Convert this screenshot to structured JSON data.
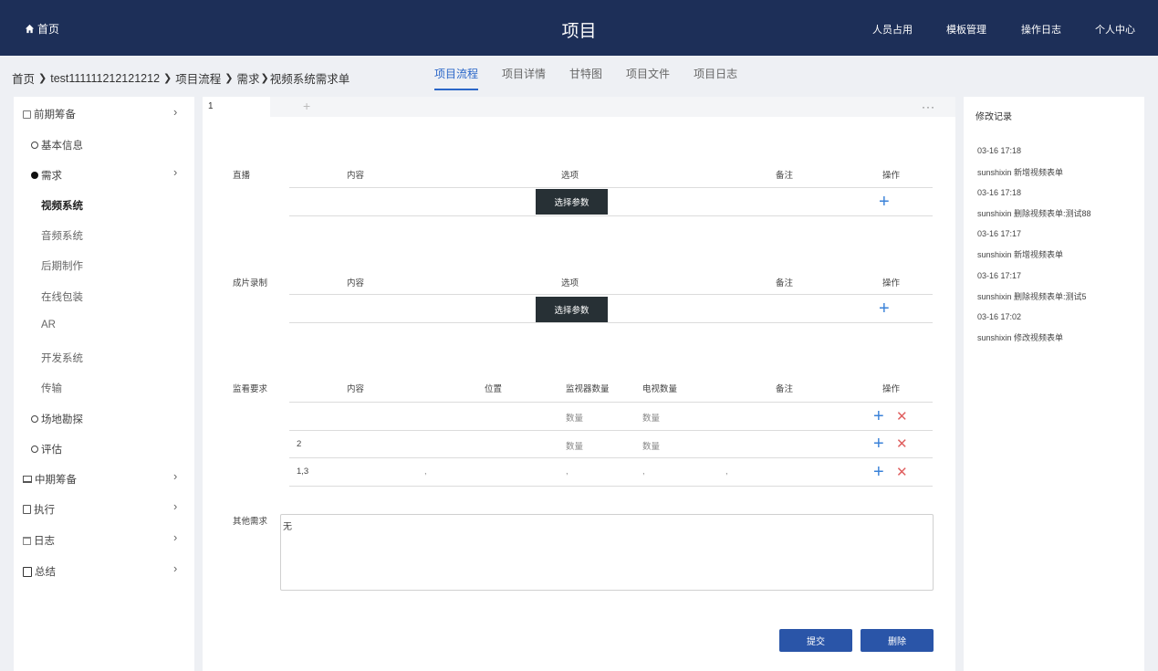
{
  "topbar": {
    "home_label": "首页",
    "title": "项目",
    "nav": [
      "人员占用",
      "模板管理",
      "操作日志",
      "个人中心"
    ]
  },
  "breadcrumb": [
    "首页",
    "test111111212121212",
    "项目流程",
    "需求",
    "视频系统需求单"
  ],
  "tabs": [
    {
      "label": "项目流程",
      "active": true
    },
    {
      "label": "项目详情",
      "active": false
    },
    {
      "label": "甘特图",
      "active": false
    },
    {
      "label": "项目文件",
      "active": false
    },
    {
      "label": "项目日志",
      "active": false
    }
  ],
  "sidebar": {
    "items": [
      {
        "label": "前期筹备",
        "icon": "square-icon",
        "expandable": true
      },
      {
        "label": "基本信息",
        "icon": "circle-outline-icon"
      },
      {
        "label": "需求",
        "icon": "circle-filled-icon",
        "expandable": true
      },
      {
        "label": "视频系统",
        "selected": true
      },
      {
        "label": "音频系统"
      },
      {
        "label": "后期制作"
      },
      {
        "label": "在线包装"
      },
      {
        "label": "AR"
      },
      {
        "label": "开发系统"
      },
      {
        "label": "传输"
      },
      {
        "label": "场地勘探",
        "icon": "circle-outline-icon"
      },
      {
        "label": "评估",
        "icon": "circle-outline-icon"
      },
      {
        "label": "中期筹备",
        "icon": "monitor-icon",
        "expandable": true
      },
      {
        "label": "执行",
        "icon": "file-icon",
        "expandable": true
      },
      {
        "label": "日志",
        "icon": "calendar-icon",
        "expandable": true
      },
      {
        "label": "总结",
        "icon": "clipboard-icon",
        "expandable": true
      }
    ]
  },
  "main": {
    "tab_label": "1",
    "tab_add": "+",
    "more": "···",
    "sections": [
      {
        "title": "直播",
        "headers": [
          "内容",
          "选项",
          "备注",
          "操作"
        ],
        "button": "选择参数"
      },
      {
        "title": "成片录制",
        "headers": [
          "内容",
          "选项",
          "备注",
          "操作"
        ],
        "button": "选择参数"
      }
    ],
    "monitor": {
      "title": "监看要求",
      "headers": [
        "内容",
        "位置",
        "监视器数量",
        "电视数量",
        "备注",
        "操作"
      ],
      "rows": [
        {
          "content": "",
          "monitors": "数量",
          "tvs": "数量"
        },
        {
          "content": "2",
          "monitors": "数量",
          "tvs": "数量"
        },
        {
          "content": "1,3",
          "pos": ",",
          "monitors": ",",
          "tvs": ",",
          "note": ","
        }
      ]
    },
    "other": {
      "title": "其他需求",
      "value": "无"
    },
    "submit_label": "提交",
    "delete_label": "删除"
  },
  "log": {
    "title": "修改记录",
    "entries": [
      {
        "time": "03-16 17:18",
        "text": "sunshixin 新增视频表单"
      },
      {
        "time": "03-16 17:18",
        "text": "sunshixin 删除视频表单:测试88"
      },
      {
        "time": "03-16 17:17",
        "text": "sunshixin 新增视频表单"
      },
      {
        "time": "03-16 17:17",
        "text": "sunshixin 删除视频表单:测试5"
      },
      {
        "time": "03-16 17:02",
        "text": "sunshixin 修改视频表单"
      }
    ]
  },
  "colors": {
    "topbar": "#1d2f58",
    "accent": "#2a66c8",
    "button": "#2a55a8",
    "dark_button": "#273035",
    "plus": "#3b82d8",
    "delete": "#e06060"
  }
}
